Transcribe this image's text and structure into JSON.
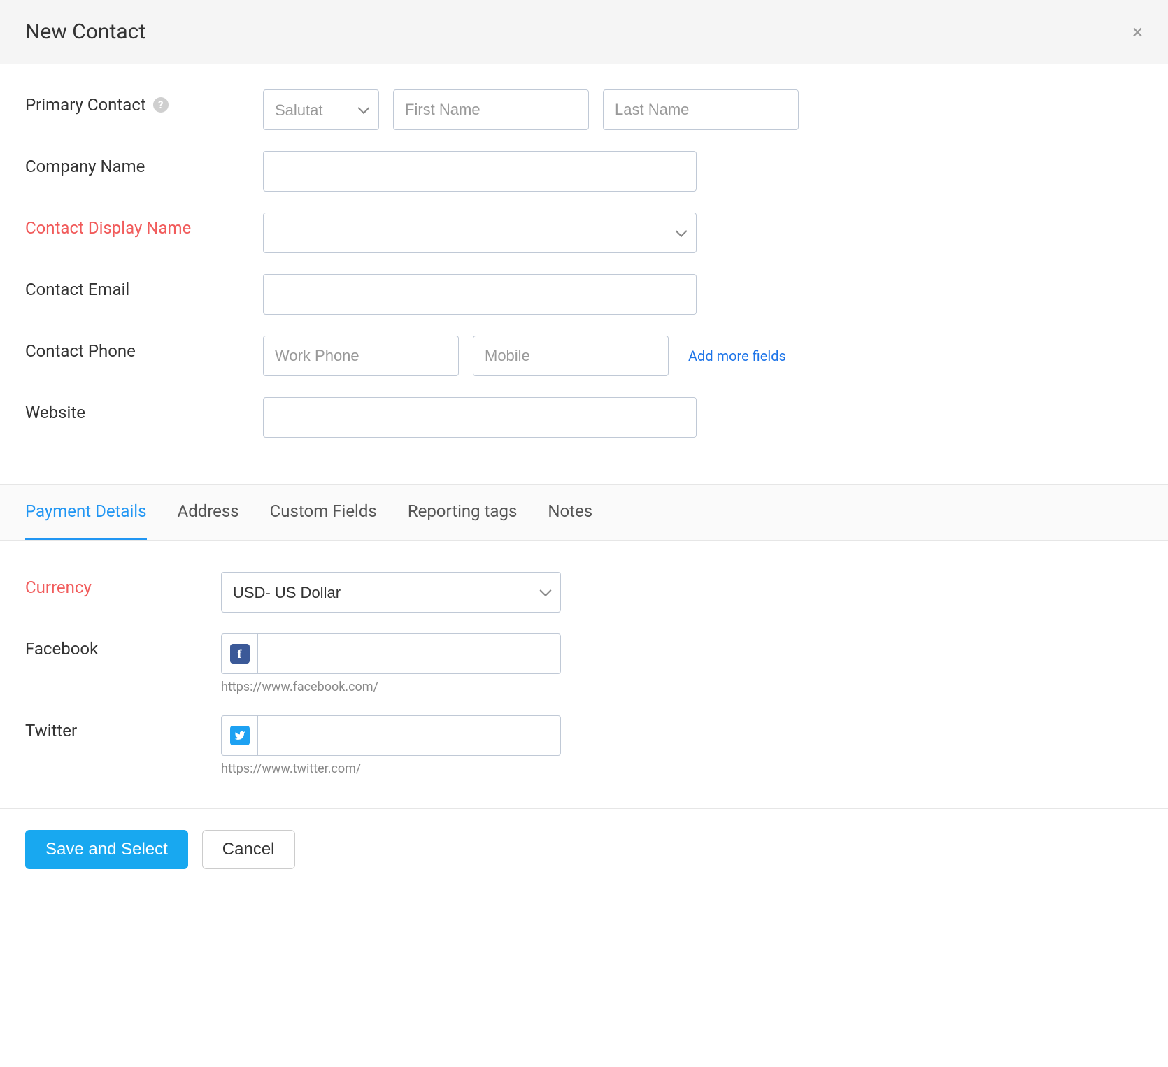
{
  "header": {
    "title": "New Contact"
  },
  "form": {
    "primary_contact_label": "Primary Contact",
    "salutation_placeholder": "Salutat",
    "first_name_placeholder": "First Name",
    "last_name_placeholder": "Last Name",
    "company_name_label": "Company Name",
    "contact_display_name_label": "Contact Display Name",
    "contact_email_label": "Contact Email",
    "contact_phone_label": "Contact Phone",
    "work_phone_placeholder": "Work Phone",
    "mobile_placeholder": "Mobile",
    "add_more_fields_link": "Add more fields",
    "website_label": "Website"
  },
  "tabs": {
    "items": [
      {
        "label": "Payment Details",
        "active": true
      },
      {
        "label": "Address",
        "active": false
      },
      {
        "label": "Custom Fields",
        "active": false
      },
      {
        "label": "Reporting tags",
        "active": false
      },
      {
        "label": "Notes",
        "active": false
      }
    ]
  },
  "payment_details": {
    "currency_label": "Currency",
    "currency_value": "USD- US Dollar",
    "facebook_label": "Facebook",
    "facebook_help": "https://www.facebook.com/",
    "twitter_label": "Twitter",
    "twitter_help": "https://www.twitter.com/"
  },
  "footer": {
    "save_label": "Save and Select",
    "cancel_label": "Cancel"
  }
}
